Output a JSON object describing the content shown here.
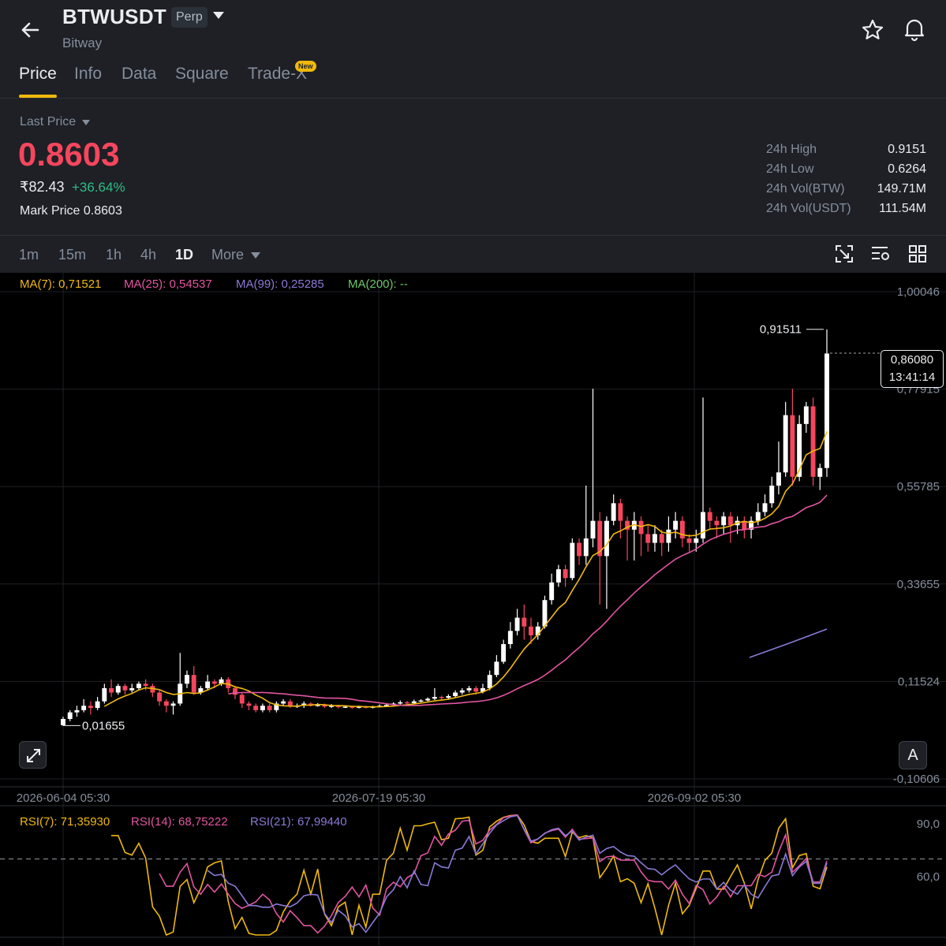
{
  "header": {
    "pair": "BTWUSDT",
    "contract_type": "Perp",
    "exchange": "Bitway",
    "icons": [
      "back-arrow-icon",
      "star-icon",
      "bell-icon"
    ]
  },
  "tabs": [
    {
      "label": "Price",
      "active": true
    },
    {
      "label": "Info",
      "active": false
    },
    {
      "label": "Data",
      "active": false
    },
    {
      "label": "Square",
      "active": false
    },
    {
      "label": "Trade-X",
      "active": false,
      "badge": "New"
    }
  ],
  "price": {
    "label": "Last Price",
    "last": "0.8603",
    "fiat": "₹82.43",
    "change": "+36.64%",
    "mark_price": "Mark Price 0.8603"
  },
  "stats": [
    {
      "label": "24h High",
      "value": "0.9151"
    },
    {
      "label": "24h Low",
      "value": "0.6264"
    },
    {
      "label": "24h Vol(BTW)",
      "value": "149.71M"
    },
    {
      "label": "24h Vol(USDT)",
      "value": "111.54M"
    }
  ],
  "intervals": [
    {
      "label": "1m",
      "active": false
    },
    {
      "label": "15m",
      "active": false
    },
    {
      "label": "1h",
      "active": false
    },
    {
      "label": "4h",
      "active": false
    },
    {
      "label": "1D",
      "active": true
    },
    {
      "label": "More",
      "active": false
    }
  ],
  "ma_legend": [
    {
      "text": "MA(7): 0,71521",
      "color": "#f0b90b"
    },
    {
      "text": "MA(25): 0,54537",
      "color": "#e255a1"
    },
    {
      "text": "MA(99): 0,25285",
      "color": "#8b79d6"
    },
    {
      "text": "MA(200): --",
      "color": "#6cc56c"
    }
  ],
  "rsi_legend": [
    {
      "text": "RSI(7): 71,35930",
      "color": "#f0b90b"
    },
    {
      "text": "RSI(14): 68,75222",
      "color": "#e255a1"
    },
    {
      "text": "RSI(21): 67,99440",
      "color": "#8b79d6"
    }
  ],
  "colors": {
    "up": "#ffffff",
    "down": "#f6465d",
    "ma7": "#f0b90b",
    "ma25": "#e255a1",
    "ma99": "#8b79d6"
  },
  "price_tag": {
    "price": "0,86080",
    "countdown": "13:41:14"
  },
  "auto_button": "A",
  "chart_data": {
    "type": "candlestick",
    "y_ticks": [
      "1,00046",
      "0,77915",
      "0,55785",
      "0,33655",
      "0,11524",
      "-0,10606"
    ],
    "ylim": [
      -0.10606,
      1.00046
    ],
    "x_ticks": [
      "2026-06-04 05:30",
      "2026-07-19 05:30",
      "2026-09-02 05:30"
    ],
    "high_annotation": "0,91511",
    "low_annotation": "0,01655",
    "rsi_ticks": [
      "90,0",
      "60,0"
    ],
    "candles": [
      [
        0.016,
        0.03,
        0.014,
        0.035
      ],
      [
        0.03,
        0.045,
        0.025,
        0.05
      ],
      [
        0.045,
        0.05,
        0.035,
        0.06
      ],
      [
        0.05,
        0.06,
        0.045,
        0.075
      ],
      [
        0.06,
        0.055,
        0.04,
        0.07
      ],
      [
        0.055,
        0.07,
        0.05,
        0.08
      ],
      [
        0.07,
        0.1,
        0.065,
        0.11
      ],
      [
        0.1,
        0.09,
        0.08,
        0.12
      ],
      [
        0.09,
        0.105,
        0.085,
        0.11
      ],
      [
        0.105,
        0.095,
        0.085,
        0.11
      ],
      [
        0.095,
        0.1,
        0.09,
        0.11
      ],
      [
        0.1,
        0.11,
        0.095,
        0.115
      ],
      [
        0.11,
        0.105,
        0.095,
        0.12
      ],
      [
        0.105,
        0.09,
        0.08,
        0.11
      ],
      [
        0.09,
        0.07,
        0.06,
        0.095
      ],
      [
        0.07,
        0.06,
        0.045,
        0.075
      ],
      [
        0.06,
        0.065,
        0.04,
        0.07
      ],
      [
        0.065,
        0.11,
        0.06,
        0.18
      ],
      [
        0.11,
        0.13,
        0.1,
        0.14
      ],
      [
        0.13,
        0.09,
        0.085,
        0.15
      ],
      [
        0.09,
        0.1,
        0.085,
        0.105
      ],
      [
        0.1,
        0.115,
        0.095,
        0.13
      ],
      [
        0.115,
        0.11,
        0.1,
        0.12
      ],
      [
        0.11,
        0.12,
        0.105,
        0.125
      ],
      [
        0.12,
        0.1,
        0.09,
        0.125
      ],
      [
        0.1,
        0.085,
        0.075,
        0.105
      ],
      [
        0.085,
        0.065,
        0.055,
        0.09
      ],
      [
        0.065,
        0.06,
        0.05,
        0.07
      ],
      [
        0.06,
        0.05,
        0.045,
        0.065
      ],
      [
        0.05,
        0.06,
        0.045,
        0.065
      ],
      [
        0.06,
        0.05,
        0.045,
        0.065
      ],
      [
        0.05,
        0.065,
        0.045,
        0.07
      ],
      [
        0.065,
        0.07,
        0.06,
        0.075
      ],
      [
        0.07,
        0.06,
        0.055,
        0.075
      ],
      [
        0.06,
        0.06,
        0.055,
        0.065
      ],
      [
        0.06,
        0.065,
        0.055,
        0.07
      ],
      [
        0.065,
        0.06,
        0.058,
        0.068
      ],
      [
        0.06,
        0.062,
        0.058,
        0.066
      ],
      [
        0.062,
        0.058,
        0.055,
        0.065
      ],
      [
        0.058,
        0.06,
        0.055,
        0.064
      ],
      [
        0.06,
        0.057,
        0.054,
        0.062
      ],
      [
        0.057,
        0.058,
        0.055,
        0.061
      ],
      [
        0.058,
        0.056,
        0.053,
        0.06
      ],
      [
        0.056,
        0.058,
        0.054,
        0.06
      ],
      [
        0.058,
        0.056,
        0.054,
        0.06
      ],
      [
        0.056,
        0.058,
        0.054,
        0.06
      ],
      [
        0.058,
        0.06,
        0.056,
        0.063
      ],
      [
        0.06,
        0.062,
        0.058,
        0.066
      ],
      [
        0.062,
        0.065,
        0.06,
        0.068
      ],
      [
        0.065,
        0.068,
        0.063,
        0.072
      ],
      [
        0.068,
        0.066,
        0.063,
        0.071
      ],
      [
        0.066,
        0.07,
        0.064,
        0.074
      ],
      [
        0.07,
        0.072,
        0.068,
        0.075
      ],
      [
        0.072,
        0.076,
        0.07,
        0.079
      ],
      [
        0.076,
        0.08,
        0.073,
        0.1
      ],
      [
        0.08,
        0.078,
        0.072,
        0.083
      ],
      [
        0.078,
        0.082,
        0.075,
        0.086
      ],
      [
        0.082,
        0.09,
        0.078,
        0.095
      ],
      [
        0.09,
        0.095,
        0.085,
        0.1
      ],
      [
        0.095,
        0.1,
        0.09,
        0.105
      ],
      [
        0.1,
        0.092,
        0.085,
        0.105
      ],
      [
        0.092,
        0.1,
        0.088,
        0.11
      ],
      [
        0.1,
        0.13,
        0.095,
        0.14
      ],
      [
        0.13,
        0.16,
        0.125,
        0.175
      ],
      [
        0.16,
        0.2,
        0.155,
        0.21
      ],
      [
        0.2,
        0.23,
        0.19,
        0.25
      ],
      [
        0.23,
        0.26,
        0.22,
        0.28
      ],
      [
        0.26,
        0.24,
        0.21,
        0.29
      ],
      [
        0.24,
        0.22,
        0.2,
        0.26
      ],
      [
        0.22,
        0.24,
        0.21,
        0.25
      ],
      [
        0.24,
        0.3,
        0.235,
        0.31
      ],
      [
        0.3,
        0.34,
        0.29,
        0.36
      ],
      [
        0.34,
        0.37,
        0.33,
        0.38
      ],
      [
        0.37,
        0.35,
        0.33,
        0.38
      ],
      [
        0.35,
        0.43,
        0.345,
        0.44
      ],
      [
        0.43,
        0.4,
        0.38,
        0.44
      ],
      [
        0.4,
        0.44,
        0.38,
        0.56
      ],
      [
        0.44,
        0.48,
        0.42,
        0.78
      ],
      [
        0.48,
        0.4,
        0.29,
        0.5
      ],
      [
        0.4,
        0.48,
        0.28,
        0.49
      ],
      [
        0.48,
        0.52,
        0.47,
        0.54
      ],
      [
        0.52,
        0.48,
        0.44,
        0.53
      ],
      [
        0.48,
        0.46,
        0.39,
        0.49
      ],
      [
        0.46,
        0.48,
        0.39,
        0.5
      ],
      [
        0.48,
        0.45,
        0.4,
        0.49
      ],
      [
        0.45,
        0.43,
        0.41,
        0.47
      ],
      [
        0.43,
        0.45,
        0.41,
        0.47
      ],
      [
        0.45,
        0.43,
        0.4,
        0.46
      ],
      [
        0.43,
        0.46,
        0.41,
        0.49
      ],
      [
        0.46,
        0.48,
        0.44,
        0.5
      ],
      [
        0.48,
        0.44,
        0.42,
        0.49
      ],
      [
        0.44,
        0.43,
        0.41,
        0.45
      ],
      [
        0.43,
        0.44,
        0.41,
        0.46
      ],
      [
        0.44,
        0.5,
        0.43,
        0.76
      ],
      [
        0.5,
        0.48,
        0.46,
        0.51
      ],
      [
        0.48,
        0.47,
        0.44,
        0.49
      ],
      [
        0.47,
        0.49,
        0.45,
        0.5
      ],
      [
        0.49,
        0.47,
        0.43,
        0.5
      ],
      [
        0.47,
        0.48,
        0.45,
        0.49
      ],
      [
        0.48,
        0.46,
        0.44,
        0.49
      ],
      [
        0.46,
        0.48,
        0.44,
        0.49
      ],
      [
        0.48,
        0.5,
        0.47,
        0.52
      ],
      [
        0.5,
        0.52,
        0.49,
        0.54
      ],
      [
        0.52,
        0.56,
        0.51,
        0.58
      ],
      [
        0.56,
        0.59,
        0.54,
        0.66
      ],
      [
        0.59,
        0.72,
        0.58,
        0.75
      ],
      [
        0.72,
        0.58,
        0.56,
        0.78
      ],
      [
        0.58,
        0.7,
        0.57,
        0.72
      ],
      [
        0.7,
        0.74,
        0.68,
        0.75
      ],
      [
        0.74,
        0.58,
        0.56,
        0.76
      ],
      [
        0.58,
        0.6,
        0.55,
        0.61
      ],
      [
        0.6,
        0.86,
        0.58,
        0.915
      ]
    ]
  }
}
